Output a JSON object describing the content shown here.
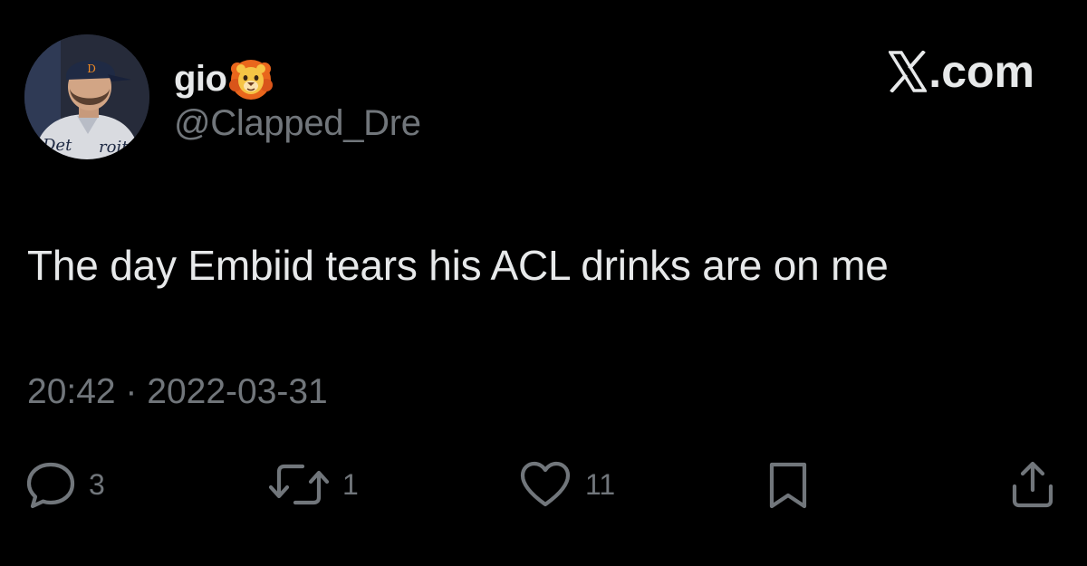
{
  "author": {
    "display_name": "gio",
    "handle": "@Clapped_Dre",
    "avatar_icon": "avatar-photo",
    "badge_icon": "lion-emoji-icon"
  },
  "brand": {
    "label": ".com",
    "icon": "x-logo-icon"
  },
  "tweet": {
    "text": "The day Embiid tears his ACL drinks are on me",
    "timestamp": "20:42 · 2022-03-31"
  },
  "actions": {
    "reply": {
      "icon": "reply-icon",
      "count": "3"
    },
    "retweet": {
      "icon": "retweet-icon",
      "count": "1"
    },
    "like": {
      "icon": "heart-icon",
      "count": "11"
    },
    "bookmark": {
      "icon": "bookmark-icon"
    },
    "share": {
      "icon": "share-icon"
    }
  },
  "colors": {
    "background": "#000000",
    "primary_text": "#e7e9ea",
    "secondary_text": "#71767b"
  }
}
